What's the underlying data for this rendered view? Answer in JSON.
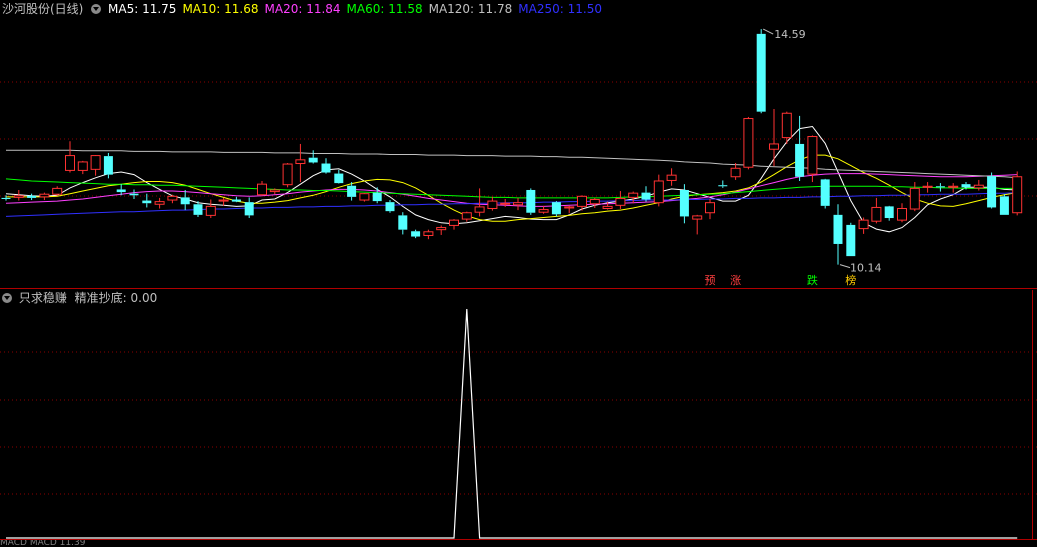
{
  "header": {
    "title": "沙河股份(日线)",
    "ma": [
      {
        "label": "MA5: 11.75",
        "color": "#ffffff"
      },
      {
        "label": "MA10: 11.68",
        "color": "#ffff00"
      },
      {
        "label": "MA20: 11.84",
        "color": "#ff40ff"
      },
      {
        "label": "MA60: 11.58",
        "color": "#00ff00"
      },
      {
        "label": "MA120: 11.78",
        "color": "#c0c0c0"
      },
      {
        "label": "MA250: 11.50",
        "color": "#3030ff"
      }
    ]
  },
  "indicator": {
    "title": "只求稳赚",
    "value_label": "精准抄底: 0.00"
  },
  "markers": {
    "high_label": "14.59",
    "low_label": "10.14",
    "tags": [
      {
        "text": "预",
        "color": "#ff4040"
      },
      {
        "text": "涨",
        "color": "#ff4040"
      },
      {
        "text": "跌",
        "color": "#00ff00"
      },
      {
        "text": "榜",
        "color": "#ffcc00"
      }
    ]
  },
  "bottom_text": "MACD MACD 11.39",
  "colors": {
    "up": "#ff3232",
    "down": "#54ffff",
    "grid": "#8b0000",
    "signal": "#ffffff"
  },
  "chart_data": [
    {
      "type": "candlestick",
      "title": "沙河股份(日线)",
      "ylim": [
        10.0,
        14.8
      ],
      "candles": [
        [
          11.4,
          11.45,
          11.35,
          11.38
        ],
        [
          11.41,
          11.55,
          11.35,
          11.44
        ],
        [
          11.44,
          11.48,
          11.36,
          11.4
        ],
        [
          11.42,
          11.5,
          11.36,
          11.47
        ],
        [
          11.47,
          11.62,
          11.44,
          11.58
        ],
        [
          11.92,
          12.47,
          11.88,
          12.2
        ],
        [
          11.92,
          12.1,
          11.85,
          12.08
        ],
        [
          11.94,
          12.21,
          11.82,
          12.2
        ],
        [
          12.19,
          12.25,
          11.77,
          11.84
        ],
        [
          11.56,
          11.66,
          11.45,
          11.51
        ],
        [
          11.48,
          11.56,
          11.38,
          11.45
        ],
        [
          11.35,
          11.48,
          11.22,
          11.3
        ],
        [
          11.28,
          11.4,
          11.2,
          11.33
        ],
        [
          11.36,
          11.46,
          11.3,
          11.43
        ],
        [
          11.41,
          11.55,
          11.17,
          11.28
        ],
        [
          11.28,
          11.34,
          11.04,
          11.08
        ],
        [
          11.07,
          11.37,
          11.02,
          11.24
        ],
        [
          11.34,
          11.4,
          11.25,
          11.36
        ],
        [
          11.37,
          11.42,
          11.32,
          11.33
        ],
        [
          11.32,
          11.41,
          11.02,
          11.07
        ],
        [
          11.46,
          11.72,
          11.44,
          11.66
        ],
        [
          11.52,
          11.58,
          11.47,
          11.55
        ],
        [
          11.65,
          12.06,
          11.6,
          12.04
        ],
        [
          12.05,
          12.42,
          11.7,
          12.12
        ],
        [
          12.16,
          12.3,
          12.05,
          12.07
        ],
        [
          12.05,
          12.15,
          11.86,
          11.88
        ],
        [
          11.86,
          11.93,
          11.67,
          11.68
        ],
        [
          11.63,
          11.7,
          11.35,
          11.42
        ],
        [
          11.36,
          11.49,
          11.33,
          11.48
        ],
        [
          11.5,
          11.6,
          11.3,
          11.34
        ],
        [
          11.32,
          11.36,
          11.12,
          11.15
        ],
        [
          11.07,
          11.13,
          10.71,
          10.8
        ],
        [
          10.77,
          10.8,
          10.64,
          10.67
        ],
        [
          10.69,
          10.8,
          10.62,
          10.76
        ],
        [
          10.8,
          10.88,
          10.7,
          10.84
        ],
        [
          10.88,
          11.0,
          10.8,
          10.98
        ],
        [
          11.0,
          11.14,
          10.95,
          11.12
        ],
        [
          11.13,
          11.58,
          11.05,
          11.23
        ],
        [
          11.2,
          11.42,
          11.16,
          11.34
        ],
        [
          11.29,
          11.38,
          11.23,
          11.3
        ],
        [
          11.27,
          11.4,
          11.17,
          11.31
        ],
        [
          11.55,
          11.58,
          11.08,
          11.12
        ],
        [
          11.13,
          11.25,
          11.1,
          11.18
        ],
        [
          11.32,
          11.34,
          11.05,
          11.09
        ],
        [
          11.21,
          11.25,
          11.11,
          11.23
        ],
        [
          11.24,
          11.45,
          11.16,
          11.43
        ],
        [
          11.29,
          11.4,
          11.21,
          11.37
        ],
        [
          11.2,
          11.33,
          11.18,
          11.24
        ],
        [
          11.26,
          11.53,
          11.19,
          11.39
        ],
        [
          11.41,
          11.52,
          11.3,
          11.49
        ],
        [
          11.5,
          11.62,
          11.33,
          11.37
        ],
        [
          11.31,
          11.84,
          11.24,
          11.72
        ],
        [
          11.73,
          11.96,
          11.63,
          11.83
        ],
        [
          11.55,
          11.66,
          10.92,
          11.05
        ],
        [
          11.0,
          11.08,
          10.71,
          11.06
        ],
        [
          11.12,
          11.38,
          11.0,
          11.31
        ],
        [
          11.64,
          11.73,
          11.59,
          11.62
        ],
        [
          11.8,
          12.06,
          11.74,
          11.96
        ],
        [
          11.98,
          12.93,
          11.94,
          12.9
        ],
        [
          14.5,
          14.59,
          13.0,
          13.03
        ],
        [
          12.32,
          13.08,
          12.0,
          12.42
        ],
        [
          12.54,
          13.03,
          12.42,
          13.0
        ],
        [
          12.42,
          12.95,
          11.72,
          11.8
        ],
        [
          11.85,
          12.58,
          11.7,
          12.56
        ],
        [
          11.75,
          11.76,
          11.2,
          11.25
        ],
        [
          11.08,
          11.28,
          10.14,
          10.53
        ],
        [
          10.89,
          10.93,
          10.3,
          10.3
        ],
        [
          10.82,
          11.03,
          10.72,
          10.98
        ],
        [
          10.96,
          11.4,
          10.92,
          11.22
        ],
        [
          11.24,
          11.25,
          10.97,
          11.02
        ],
        [
          10.98,
          11.3,
          10.94,
          11.2
        ],
        [
          11.19,
          11.7,
          11.15,
          11.58
        ],
        [
          11.6,
          11.7,
          11.5,
          11.62
        ],
        [
          11.62,
          11.68,
          11.52,
          11.6
        ],
        [
          11.6,
          11.68,
          11.5,
          11.62
        ],
        [
          11.66,
          11.7,
          11.56,
          11.6
        ],
        [
          11.59,
          11.74,
          11.54,
          11.64
        ],
        [
          11.81,
          11.88,
          11.2,
          11.22
        ],
        [
          11.43,
          11.47,
          11.08,
          11.08
        ],
        [
          11.12,
          11.9,
          11.07,
          11.8
        ]
      ],
      "series": [
        {
          "name": "MA5",
          "values": [
            11.48,
            11.46,
            11.44,
            11.43,
            11.45,
            11.59,
            11.69,
            11.78,
            11.86,
            11.89,
            11.84,
            11.69,
            11.56,
            11.44,
            11.38,
            11.31,
            11.28,
            11.26,
            11.24,
            11.25,
            11.36,
            11.38,
            11.5,
            11.66,
            11.82,
            11.93,
            11.95,
            11.85,
            11.72,
            11.56,
            11.42,
            11.24,
            11.08,
            10.99,
            10.93,
            10.91,
            10.93,
            10.97,
            11.01,
            11.05,
            11.03,
            11.0,
            10.99,
            10.99,
            11.08,
            11.19,
            11.26,
            11.31,
            11.34,
            11.38,
            11.43,
            11.51,
            11.57,
            11.55,
            11.48,
            11.41,
            11.34,
            11.34,
            11.45,
            11.77,
            12.14,
            12.46,
            12.71,
            12.75,
            12.43,
            11.89,
            11.35,
            10.93,
            10.81,
            10.76,
            10.84,
            11.03,
            11.27,
            11.38,
            11.46,
            11.6,
            11.6,
            11.6,
            11.56,
            11.55
          ]
        },
        {
          "name": "MA10",
          "values": [
            11.42,
            11.42,
            11.42,
            11.42,
            11.43,
            11.48,
            11.53,
            11.58,
            11.63,
            11.66,
            11.69,
            11.71,
            11.71,
            11.69,
            11.64,
            11.56,
            11.48,
            11.41,
            11.34,
            11.3,
            11.3,
            11.32,
            11.35,
            11.4,
            11.45,
            11.52,
            11.6,
            11.67,
            11.72,
            11.75,
            11.74,
            11.69,
            11.59,
            11.45,
            11.3,
            11.17,
            11.06,
            10.99,
            10.96,
            10.96,
            10.99,
            11.01,
            11.03,
            11.05,
            11.07,
            11.1,
            11.12,
            11.15,
            11.17,
            11.21,
            11.26,
            11.31,
            11.38,
            11.43,
            11.46,
            11.48,
            11.5,
            11.53,
            11.59,
            11.7,
            11.84,
            11.99,
            12.12,
            12.21,
            12.21,
            12.14,
            12.01,
            11.88,
            11.77,
            11.64,
            11.5,
            11.38,
            11.3,
            11.25,
            11.24,
            11.29,
            11.35,
            11.41,
            11.46,
            11.5
          ]
        },
        {
          "name": "MA20",
          "values": [
            11.3,
            11.31,
            11.32,
            11.33,
            11.34,
            11.36,
            11.38,
            11.41,
            11.44,
            11.47,
            11.5,
            11.52,
            11.53,
            11.53,
            11.52,
            11.5,
            11.48,
            11.46,
            11.44,
            11.43,
            11.44,
            11.46,
            11.48,
            11.51,
            11.53,
            11.55,
            11.56,
            11.56,
            11.55,
            11.53,
            11.5,
            11.47,
            11.43,
            11.39,
            11.36,
            11.33,
            11.3,
            11.28,
            11.27,
            11.26,
            11.25,
            11.24,
            11.24,
            11.25,
            11.26,
            11.27,
            11.28,
            11.29,
            11.3,
            11.31,
            11.32,
            11.33,
            11.35,
            11.37,
            11.39,
            11.42,
            11.46,
            11.51,
            11.57,
            11.63,
            11.69,
            11.75,
            11.8,
            11.83,
            11.85,
            11.86,
            11.86,
            11.86,
            11.85,
            11.84,
            11.83,
            11.82,
            11.81,
            11.8,
            11.8,
            11.8,
            11.81,
            11.82,
            11.83,
            11.84
          ]
        },
        {
          "name": "MA60",
          "values": [
            11.76,
            11.74,
            11.72,
            11.71,
            11.7,
            11.69,
            11.68,
            11.67,
            11.66,
            11.66,
            11.65,
            11.65,
            11.64,
            11.64,
            11.63,
            11.62,
            11.61,
            11.6,
            11.59,
            11.58,
            11.57,
            11.56,
            11.55,
            11.55,
            11.54,
            11.54,
            11.53,
            11.52,
            11.51,
            11.5,
            11.49,
            11.48,
            11.47,
            11.46,
            11.45,
            11.44,
            11.43,
            11.42,
            11.41,
            11.41,
            11.4,
            11.4,
            11.4,
            11.4,
            11.4,
            11.4,
            11.4,
            11.4,
            11.41,
            11.42,
            11.42,
            11.43,
            11.44,
            11.45,
            11.46,
            11.47,
            11.48,
            11.5,
            11.52,
            11.54,
            11.56,
            11.58,
            11.6,
            11.61,
            11.62,
            11.62,
            11.62,
            11.62,
            11.62,
            11.61,
            11.61,
            11.6,
            11.6,
            11.59,
            11.59,
            11.58,
            11.58,
            11.58,
            11.58,
            11.58
          ]
        },
        {
          "name": "MA120",
          "values": [
            12.3,
            12.3,
            12.3,
            12.3,
            12.3,
            12.3,
            12.29,
            12.29,
            12.29,
            12.29,
            12.28,
            12.28,
            12.28,
            12.27,
            12.27,
            12.27,
            12.27,
            12.26,
            12.26,
            12.26,
            12.26,
            12.25,
            12.25,
            12.25,
            12.24,
            12.24,
            12.24,
            12.23,
            12.23,
            12.23,
            12.22,
            12.22,
            12.22,
            12.21,
            12.21,
            12.21,
            12.2,
            12.2,
            12.2,
            12.19,
            12.19,
            12.19,
            12.18,
            12.18,
            12.17,
            12.17,
            12.16,
            12.15,
            12.14,
            12.13,
            12.12,
            12.11,
            12.1,
            12.08,
            12.07,
            12.06,
            12.04,
            12.03,
            12.02,
            12.0,
            11.99,
            11.98,
            11.97,
            11.96,
            11.94,
            11.93,
            11.92,
            11.91,
            11.9,
            11.89,
            11.88,
            11.87,
            11.86,
            11.85,
            11.84,
            11.83,
            11.82,
            11.81,
            11.8,
            11.78
          ]
        },
        {
          "name": "MA250",
          "values": [
            11.05,
            11.06,
            11.07,
            11.08,
            11.09,
            11.1,
            11.11,
            11.12,
            11.13,
            11.14,
            11.14,
            11.15,
            11.16,
            11.17,
            11.17,
            11.18,
            11.19,
            11.19,
            11.2,
            11.21,
            11.21,
            11.22,
            11.22,
            11.23,
            11.23,
            11.24,
            11.24,
            11.25,
            11.25,
            11.26,
            11.26,
            11.27,
            11.27,
            11.28,
            11.28,
            11.29,
            11.29,
            11.3,
            11.3,
            11.31,
            11.31,
            11.31,
            11.32,
            11.32,
            11.33,
            11.33,
            11.34,
            11.34,
            11.35,
            11.35,
            11.36,
            11.36,
            11.36,
            11.37,
            11.37,
            11.38,
            11.38,
            11.39,
            11.39,
            11.4,
            11.4,
            11.41,
            11.41,
            11.42,
            11.42,
            11.43,
            11.43,
            11.44,
            11.44,
            11.45,
            11.45,
            11.46,
            11.46,
            11.47,
            11.47,
            11.47,
            11.48,
            11.49,
            11.49,
            11.5
          ]
        }
      ]
    },
    {
      "type": "line",
      "title": "只求稳赚",
      "series": [
        {
          "name": "精准抄底",
          "values": [
            0,
            0,
            0,
            0,
            0,
            0,
            0,
            0,
            0,
            0,
            0,
            0,
            0,
            0,
            0,
            0,
            0,
            0,
            0,
            0,
            0,
            0,
            0,
            0,
            0,
            0,
            0,
            0,
            0,
            0,
            0,
            0,
            0,
            0,
            0,
            0,
            1,
            0,
            0,
            0,
            0,
            0,
            0,
            0,
            0,
            0,
            0,
            0,
            0,
            0,
            0,
            0,
            0,
            0,
            0,
            0,
            0,
            0,
            0,
            0,
            0,
            0,
            0,
            0,
            0,
            0,
            0,
            0,
            0,
            0,
            0,
            0,
            0,
            0,
            0,
            0,
            0,
            0,
            0,
            0
          ]
        }
      ],
      "ylim": [
        0,
        1
      ]
    }
  ]
}
